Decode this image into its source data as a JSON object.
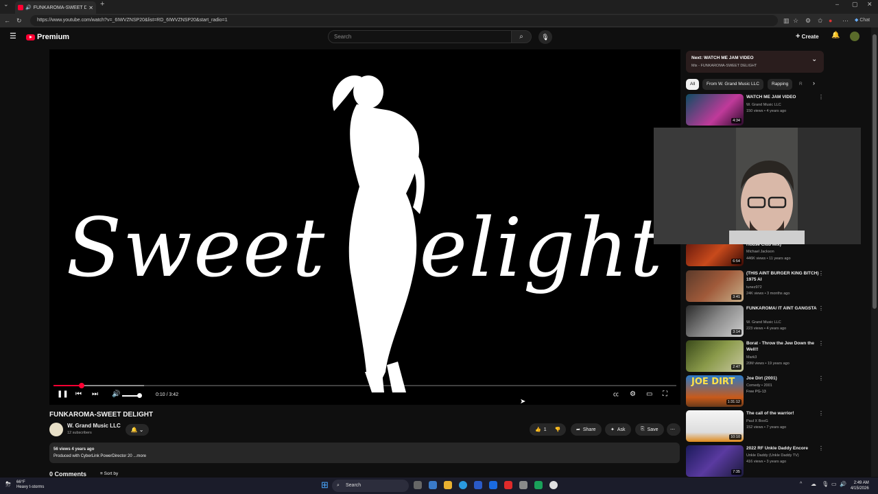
{
  "browser": {
    "tab_title": "FUNKAROMA-SWEET DELIGHT",
    "url": "https://www.youtube.com/watch?v=_6IWVZNSP20&list=RD_6IWVZNSP20&start_radio=1",
    "copilot_label": "Chat"
  },
  "header": {
    "logo_text": "Premium",
    "search_placeholder": "Search",
    "create_label": "Create"
  },
  "player": {
    "overlay_title": "Sweet Delight",
    "time": "0:10 / 3:42",
    "progress_fraction": 0.045,
    "buffered_fraction": 0.145,
    "volume_fraction": 1.0
  },
  "video": {
    "title": "FUNKAROMA-SWEET DELIGHT",
    "channel": "W. Grand Music LLC",
    "subscribers": "12 subscribers",
    "likes": "1",
    "share_label": "Share",
    "ask_label": "Ask",
    "save_label": "Save",
    "stats": "56 views  4 years ago",
    "description": "Produced with CyberLink PowerDirector 20 ...more",
    "comments_label": "0 Comments",
    "sort_label": "Sort by"
  },
  "sidebar": {
    "next_label": "Next: WATCH ME JAM VIDEO",
    "next_sub": "Mix - FUNKAROMA-SWEET DELIGHT",
    "chips": [
      "All",
      "From W. Grand Music LLC",
      "Rapping",
      "R"
    ],
    "videos": [
      {
        "title": "WATCH ME JAM VIDEO",
        "channel": "W. Grand Music LLC",
        "meta": "150 views • 4 years ago",
        "duration": "4:34"
      },
      {
        "title": "House Club Mix)",
        "channel": "Michael Jackson",
        "meta": "446K views • 11 years ago",
        "duration": "6:54"
      },
      {
        "title": "(THIS AINT BURGER KING BITCH) 1975 AI",
        "channel": "tunez972",
        "meta": "24K views • 3 months ago",
        "duration": "3:41"
      },
      {
        "title": "FUNKAROMA/ IT AINT GANGSTA",
        "channel": "W. Grand Music LLC",
        "meta": "223 views • 4 years ago",
        "duration": "3:14"
      },
      {
        "title": "Borat - Throw the Jew Down the Well!!",
        "channel": "Mark3",
        "meta": "20M views • 19 years ago",
        "duration": "2:47"
      },
      {
        "title": "Joe Dirt (2001)",
        "channel": "Comedy • 2001",
        "meta": "Free  PG-13",
        "duration": "1:31:12"
      },
      {
        "title": "The call of the warrior!",
        "channel": "Paul X BooG",
        "meta": "152 views • 7 years ago",
        "duration": "10:10"
      },
      {
        "title": "2022 RF Unkle Daddy Encore",
        "channel": "Unkle Daddy (Unkle Daddy TV)",
        "meta": "416 views • 3 years ago",
        "duration": "7:35"
      }
    ]
  },
  "taskbar": {
    "weather_temp": "66°F",
    "weather_desc": "Heavy t-storms",
    "search_label": "Search",
    "time": "2:49 AM",
    "date": "4/15/2026"
  }
}
